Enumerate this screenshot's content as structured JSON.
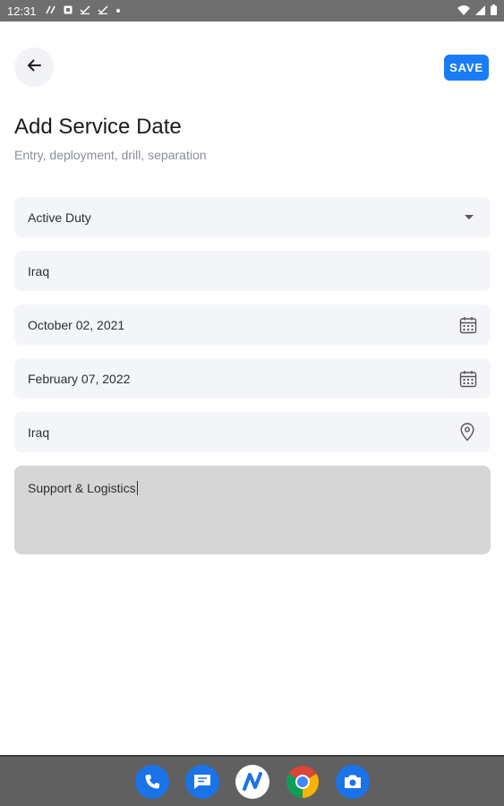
{
  "status_bar": {
    "time": "12:31",
    "left_icons": [
      "signal-strength-icon",
      "notification-icon",
      "checkmark-icon",
      "checkmark-icon",
      "dot-icon"
    ],
    "right_icons": [
      "wifi-icon",
      "cellular-icon",
      "battery-icon"
    ]
  },
  "header": {
    "save_label": "SAVE",
    "title": "Add Service Date",
    "subtitle": "Entry, deployment, drill, separation"
  },
  "form": {
    "service_type": "Active Duty",
    "country": "Iraq",
    "start_date": "October 02, 2021",
    "end_date": "February 07, 2022",
    "location": "Iraq",
    "notes": "Support & Logistics"
  },
  "colors": {
    "accent": "#1a7cf5",
    "field_bg": "#f3f5f8",
    "textarea_bg": "#d6d6d6",
    "status_bar_bg": "#6f6f6f"
  },
  "dock": [
    "phone-icon",
    "messages-icon",
    "app-icon",
    "chrome-icon",
    "camera-icon"
  ]
}
